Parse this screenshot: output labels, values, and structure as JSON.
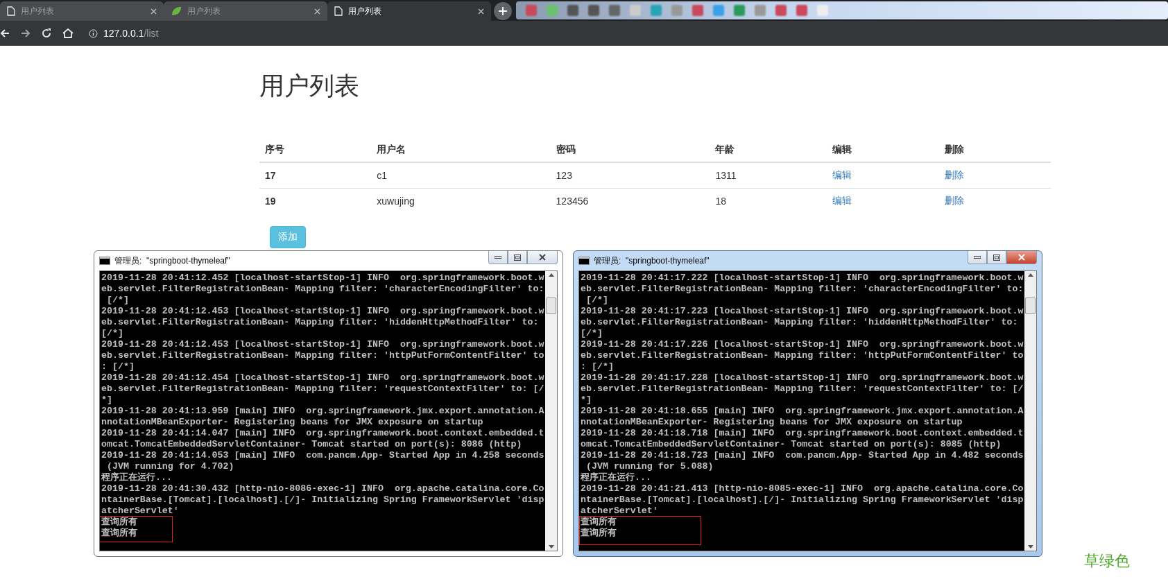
{
  "browser": {
    "tabs": [
      {
        "title": "用户列表",
        "selected": false
      },
      {
        "title": "用户列表",
        "selected": false
      },
      {
        "title": "用户列表",
        "selected": true
      }
    ],
    "address": {
      "host": "127.0.0.1",
      "path": "/list"
    }
  },
  "page": {
    "title": "用户列表",
    "table": {
      "columns": [
        "序号",
        "用户名",
        "密码",
        "年龄",
        "编辑",
        "删除"
      ],
      "rows": [
        {
          "id": "17",
          "username": "c1",
          "password": "123",
          "age": "1311",
          "edit": "编辑",
          "delete": "删除"
        },
        {
          "id": "19",
          "username": "xuwujing",
          "password": "123456",
          "age": "18",
          "edit": "编辑",
          "delete": "删除"
        }
      ]
    },
    "add_button": "添加"
  },
  "consoles": [
    {
      "title": "管理员:  \"springboot-thymeleaf\"",
      "active": false,
      "highlight_box": true,
      "lines": [
        "2019-11-28 20:41:12.452 [localhost-startStop-1] INFO  org.springframework.boot.w",
        "eb.servlet.FilterRegistrationBean- Mapping filter: 'characterEncodingFilter' to:",
        " [/*]",
        "2019-11-28 20:41:12.453 [localhost-startStop-1] INFO  org.springframework.boot.w",
        "eb.servlet.FilterRegistrationBean- Mapping filter: 'hiddenHttpMethodFilter' to:",
        "[/*]",
        "2019-11-28 20:41:12.453 [localhost-startStop-1] INFO  org.springframework.boot.w",
        "eb.servlet.FilterRegistrationBean- Mapping filter: 'httpPutFormContentFilter' to",
        ": [/*]",
        "2019-11-28 20:41:12.454 [localhost-startStop-1] INFO  org.springframework.boot.w",
        "eb.servlet.FilterRegistrationBean- Mapping filter: 'requestContextFilter' to: [/",
        "*]",
        "2019-11-28 20:41:13.959 [main] INFO  org.springframework.jmx.export.annotation.A",
        "nnotationMBeanExporter- Registering beans for JMX exposure on startup",
        "2019-11-28 20:41:14.047 [main] INFO  org.springframework.boot.context.embedded.t",
        "omcat.TomcatEmbeddedServletContainer- Tomcat started on port(s): 8086 (http)",
        "2019-11-28 20:41:14.053 [main] INFO  com.pancm.App- Started App in 4.258 seconds",
        " (JVM running for 4.702)",
        "程序正在运行...",
        "2019-11-28 20:41:30.432 [http-nio-8086-exec-1] INFO  org.apache.catalina.core.Co",
        "ntainerBase.[Tomcat].[localhost].[/]- Initializing Spring FrameworkServlet 'disp",
        "atcherServlet'",
        "查询所有",
        "查询所有"
      ]
    },
    {
      "title": "管理员:  \"springboot-thymeleaf\"",
      "active": true,
      "highlight_box": true,
      "lines": [
        "2019-11-28 20:41:17.222 [localhost-startStop-1] INFO  org.springframework.boot.w",
        "eb.servlet.FilterRegistrationBean- Mapping filter: 'characterEncodingFilter' to:",
        " [/*]",
        "2019-11-28 20:41:17.223 [localhost-startStop-1] INFO  org.springframework.boot.w",
        "eb.servlet.FilterRegistrationBean- Mapping filter: 'hiddenHttpMethodFilter' to:",
        "[/*]",
        "2019-11-28 20:41:17.226 [localhost-startStop-1] INFO  org.springframework.boot.w",
        "eb.servlet.FilterRegistrationBean- Mapping filter: 'httpPutFormContentFilter' to",
        ": [/*]",
        "2019-11-28 20:41:17.228 [localhost-startStop-1] INFO  org.springframework.boot.w",
        "eb.servlet.FilterRegistrationBean- Mapping filter: 'requestContextFilter' to: [/",
        "*]",
        "2019-11-28 20:41:18.655 [main] INFO  org.springframework.jmx.export.annotation.A",
        "nnotationMBeanExporter- Registering beans for JMX exposure on startup",
        "2019-11-28 20:41:18.718 [main] INFO  org.springframework.boot.context.embedded.t",
        "omcat.TomcatEmbeddedServletContainer- Tomcat started on port(s): 8085 (http)",
        "2019-11-28 20:41:18.723 [main] INFO  com.pancm.App- Started App in 4.482 seconds",
        " (JVM running for 5.088)",
        "程序正在运行...",
        "2019-11-28 20:41:21.413 [http-nio-8085-exec-1] INFO  org.apache.catalina.core.Co",
        "ntainerBase.[Tomcat].[localhost].[/]- Initializing Spring FrameworkServlet 'disp",
        "atcherServlet'",
        "查询所有",
        "查询所有"
      ]
    }
  ],
  "caption": "草绿色"
}
